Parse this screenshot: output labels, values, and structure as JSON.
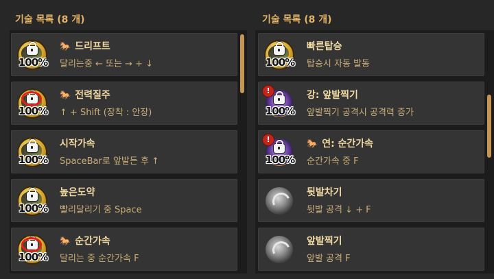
{
  "left_panel": {
    "title": "기술 목록 (8 개)",
    "items": [
      {
        "name": "드리프트",
        "mount_icon": true,
        "desc": "달리는중 ← 또는 → + ↓",
        "level": "100%",
        "icon": "locked-medal-icon",
        "red_ring": false
      },
      {
        "name": "전력질주",
        "mount_icon": true,
        "desc": "↑ + Shift (장착 : 안장)",
        "level": "100%",
        "icon": "locked-medal-icon",
        "red_ring": true
      },
      {
        "name": "시작가속",
        "mount_icon": false,
        "desc": "SpaceBar로 앞발든 후 ↑",
        "level": "100%",
        "icon": "locked-medal-icon",
        "red_ring": false
      },
      {
        "name": "높은도약",
        "mount_icon": false,
        "desc": "빨리달리기 중 Space",
        "level": "100%",
        "icon": "locked-medal-icon",
        "red_ring": false
      },
      {
        "name": "순간가속",
        "mount_icon": true,
        "desc": "달리는 중 순간가속 F",
        "level": "100%",
        "icon": "locked-medal-icon",
        "red_ring": true
      }
    ]
  },
  "right_panel": {
    "title": "기술 목록 (8 개)",
    "items": [
      {
        "name": "빠른탑승",
        "mount_icon": false,
        "desc": "탑승시 자동 발동",
        "level": "100%",
        "icon": "locked-medal-icon",
        "alert": false
      },
      {
        "name": "강: 앞발찍기",
        "mount_icon": false,
        "desc": "앞발찍기 공격시 공격력 증가",
        "level": "100%",
        "icon": "purple-skill-icon",
        "alert": true
      },
      {
        "name": "연: 순간가속",
        "mount_icon": true,
        "desc": "순간가속 중 F",
        "level": "100%",
        "icon": "purple-skill-icon",
        "alert": true
      },
      {
        "name": "뒷발차기",
        "mount_icon": false,
        "desc": "뒷발 공격 ↓ + F",
        "level": "",
        "icon": "gray-skill-icon",
        "alert": false
      },
      {
        "name": "앞발찍기",
        "mount_icon": false,
        "desc": "앞발 공격 F",
        "level": "",
        "icon": "gray-skill-icon",
        "alert": false
      }
    ]
  },
  "colors": {
    "title": "#e2b266",
    "name": "#f0d9a2",
    "desc": "#c9ad77",
    "scrollbar": "#c39556",
    "alert": "#c0261c"
  },
  "alert_glyph": "!",
  "mount_glyph": "🐎"
}
